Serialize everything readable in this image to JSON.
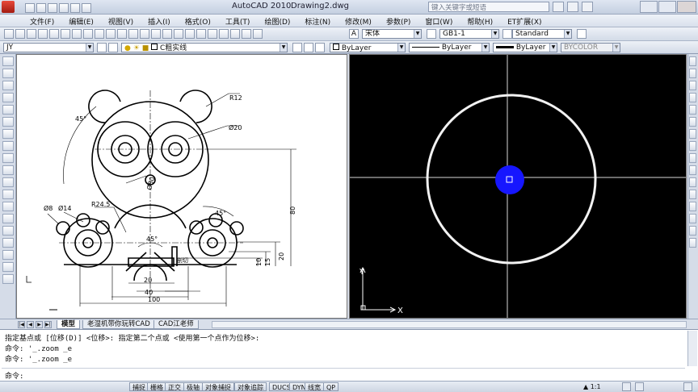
{
  "window": {
    "app_title": "AutoCAD 2010",
    "document": "Drawing2.dwg",
    "search_placeholder": "键入关键字或短语"
  },
  "menu": [
    "文件(F)",
    "编辑(E)",
    "视图(V)",
    "插入(I)",
    "格式(O)",
    "工具(T)",
    "绘图(D)",
    "标注(N)",
    "修改(M)",
    "参数(P)",
    "窗口(W)",
    "帮助(H)",
    "ET扩展(X)"
  ],
  "toolbar1": {
    "text_font": "宋体",
    "dim_style": "GB1-1",
    "table_style": "Standard"
  },
  "toolbar2": {
    "layer": "JY",
    "layer_name": "C粗实线",
    "color": "ByLayer",
    "linetype": "ByLayer",
    "lineweight": "ByLayer",
    "plotstyle": "BYCOLOR"
  },
  "drawing": {
    "dims": {
      "r12": "R12",
      "phi20": "Ø20",
      "a45_top": "45°",
      "phi80": "Ø80",
      "r24_5": "R24.5",
      "phi8": "Ø8",
      "phi14": "Ø14",
      "a45_right": "45°",
      "a45_bottom": "45°",
      "d80": "80",
      "d20v": "20",
      "d15": "15",
      "d10": "10",
      "d20h": "20",
      "d40": "40",
      "d100": "100",
      "cut_label": "剖切"
    }
  },
  "ucs": {
    "x": "X",
    "y": "Y"
  },
  "tabs": {
    "model": "模型",
    "layout1": "老湿机带你玩转CAD",
    "layout2": "CAD江老师"
  },
  "command": {
    "line1": "指定基点或 [位移(D)] <位移>:  指定第二个点或 <使用第一个点作为位移>:",
    "line2": "命令: '_.zoom _e",
    "line3": "命令: '_.zoom _e",
    "prompt": "命令:"
  },
  "status": {
    "buttons": [
      "捕捉",
      "栅格",
      "正交",
      "极轴",
      "对象捕捉",
      "对象追踪",
      "DUCS",
      "DYN",
      "线宽",
      "QP"
    ],
    "scale": "1:1"
  },
  "colors": {
    "viewport_bg": "#000000",
    "highlight": "#1616ff"
  }
}
